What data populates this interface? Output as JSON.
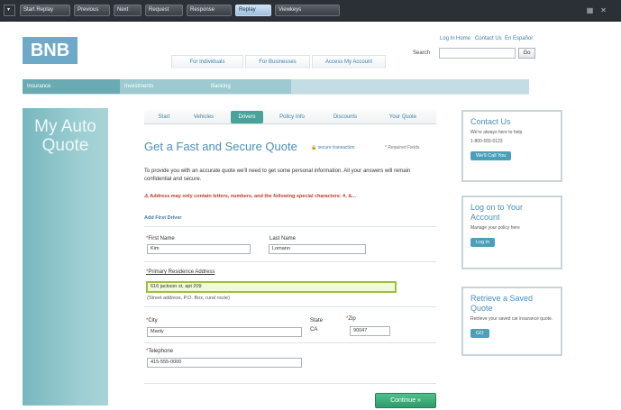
{
  "toolbar": {
    "buttons": [
      {
        "label": "Start Replay"
      },
      {
        "label": "Previous"
      },
      {
        "label": "Next"
      },
      {
        "label": "Request"
      },
      {
        "label": "Response"
      },
      {
        "label": "Replay",
        "active": true
      },
      {
        "label": "Viewkeys"
      }
    ],
    "menu_icon": "dropdown-arrow-icon",
    "corner_icons": [
      "grid-icon",
      "close-icon"
    ]
  },
  "header": {
    "logo": "BNB",
    "nav_tabs": [
      "For Individuals",
      "For Businesses",
      "Access My Account"
    ],
    "top_links": [
      "Log In",
      "Home",
      "Contact Us",
      "En Español"
    ],
    "search_label": "Search",
    "search_value": "",
    "search_button": "Go"
  },
  "category_tabs": [
    "Insurance",
    "Investments",
    "Banking"
  ],
  "banner": {
    "title": "My Auto Quote"
  },
  "steps": {
    "items": [
      "Start",
      "Vehicles",
      "Drivers",
      "Policy Info",
      "Discounts",
      "Your Quote"
    ],
    "active": "Drivers"
  },
  "form": {
    "title": "Get a Fast and Secure Quote",
    "secure_link": "secure transaction",
    "required_note": "* Required Fields",
    "intro": "To provide you with an accurate quote we'll need to get some personal information. All your answers will remain confidential and secure.",
    "error": "Address may only contain letters, numbers, and the following special characters: #, &...",
    "add_driver": "Add First Driver",
    "first_name": {
      "label": "First Name",
      "value": "Kim"
    },
    "last_name": {
      "label": "Last Name",
      "value": "Lomann"
    },
    "address": {
      "label": "Primary Residence Address",
      "value": "616 jackson st, apt 209",
      "hint": "(Street address, P.O. Box, rural route)"
    },
    "city": {
      "label": "City",
      "value": "Manly"
    },
    "state": {
      "label": "State",
      "value": "CA"
    },
    "zip": {
      "label": "Zip",
      "value": "90047"
    },
    "telephone": {
      "label": "Telephone",
      "value": "415-555-0000"
    },
    "continue_label": "Continue »"
  },
  "sidebar": {
    "contact": {
      "title": "Contact Us",
      "text1": "We're always here to help.",
      "text2": "1-800-555-0123",
      "button": "We'll Call You"
    },
    "login": {
      "title": "Log on to Your Account",
      "text": "Manage your policy here",
      "button": "Log In"
    },
    "retrieve": {
      "title": "Retrieve a Saved Quote",
      "text": "Retrieve your saved car insurance quote.",
      "button": "GO"
    }
  },
  "colors": {
    "accent": "#4a8fb8",
    "banner": "#78b7bf",
    "continue": "#2f9c69",
    "error": "#c0392b"
  }
}
